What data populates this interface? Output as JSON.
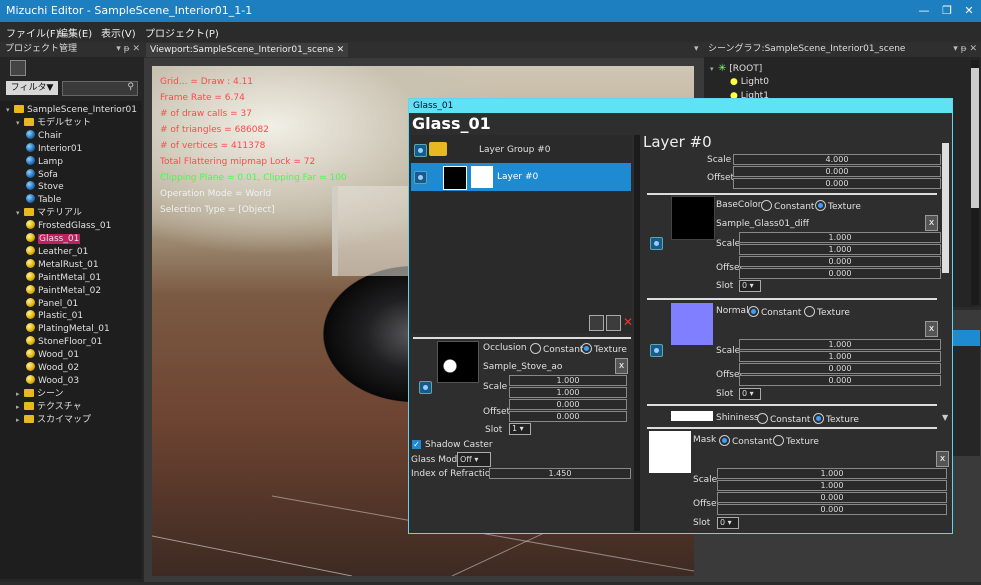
{
  "app": {
    "title": "Mizuchi Editor - SampleScene_Interior01_1-1"
  },
  "menu": [
    "ファイル(F)",
    "編集(E)",
    "表示(V)",
    "プロジェクト(P)"
  ],
  "project_panel": {
    "title": "プロジェクト管理",
    "filter_label": "フィルタ▼",
    "tree": [
      {
        "label": "SampleScene_Interior01",
        "icon": "folder",
        "indent": 0
      },
      {
        "label": "モデルセット",
        "icon": "folder",
        "indent": 1
      },
      {
        "label": "Chair",
        "icon": "blue",
        "indent": 2
      },
      {
        "label": "Interior01",
        "icon": "blue",
        "indent": 2
      },
      {
        "label": "Lamp",
        "icon": "blue",
        "indent": 2
      },
      {
        "label": "Sofa",
        "icon": "blue",
        "indent": 2
      },
      {
        "label": "Stove",
        "icon": "blue",
        "indent": 2
      },
      {
        "label": "Table",
        "icon": "blue",
        "indent": 2
      },
      {
        "label": "マテリアル",
        "icon": "folder",
        "indent": 1
      },
      {
        "label": "FrostedGlass_01",
        "icon": "gold",
        "indent": 2
      },
      {
        "label": "Glass_01",
        "icon": "gold",
        "indent": 2,
        "selected": true
      },
      {
        "label": "Leather_01",
        "icon": "gold",
        "indent": 2
      },
      {
        "label": "MetalRust_01",
        "icon": "gold",
        "indent": 2
      },
      {
        "label": "PaintMetal_01",
        "icon": "gold",
        "indent": 2
      },
      {
        "label": "PaintMetal_02",
        "icon": "gold",
        "indent": 2
      },
      {
        "label": "Panel_01",
        "icon": "gold",
        "indent": 2
      },
      {
        "label": "Plastic_01",
        "icon": "gold",
        "indent": 2
      },
      {
        "label": "PlatingMetal_01",
        "icon": "gold",
        "indent": 2
      },
      {
        "label": "StoneFloor_01",
        "icon": "gold",
        "indent": 2
      },
      {
        "label": "Wood_01",
        "icon": "gold",
        "indent": 2
      },
      {
        "label": "Wood_02",
        "icon": "gold",
        "indent": 2
      },
      {
        "label": "Wood_03",
        "icon": "gold",
        "indent": 2
      },
      {
        "label": "シーン",
        "icon": "folder",
        "indent": 1
      },
      {
        "label": "テクスチャ",
        "icon": "folder",
        "indent": 1
      },
      {
        "label": "スカイマップ",
        "icon": "folder",
        "indent": 1
      }
    ]
  },
  "viewport": {
    "tab": "Viewport:SampleScene_Interior01_scene",
    "overlay": [
      "Grid... = Draw : 4.11",
      "Frame Rate = 6.74",
      "# of draw calls = 37",
      "# of triangles = 686082",
      "# of vertices = 411378",
      "Total Flattering mipmap Lock = 72",
      "Clipping Plane = 0.01, Clipping Far = 100",
      "Operation Mode = World",
      "Selection Type = [Object]"
    ]
  },
  "scene_graph": {
    "title": "シーングラフ:SampleScene_Interior01_scene",
    "items": [
      "[ROOT]",
      "Light0",
      "Light1"
    ]
  },
  "dialog": {
    "title": "Glass_01",
    "heading": "Glass_01",
    "layers": [
      "Layer Group #0",
      "Layer #0"
    ],
    "occlusion": {
      "label": "Occlusion",
      "constant": "Constant",
      "texture": "Texture",
      "file": "Sample_Stove_ao",
      "scale_label": "Scale",
      "scale": [
        "1.000",
        "1.000"
      ],
      "offset_label": "Offset",
      "offset": [
        "0.000",
        "0.000"
      ],
      "slot_label": "Slot",
      "slot": "1"
    },
    "shadow_caster": "Shadow Caster",
    "glass_mode_label": "Glass Mode",
    "glass_mode": "Off",
    "ior_label": "Index of Refraction",
    "ior": "1.450",
    "layer_heading": "Layer #0",
    "layer_scale_label": "Scale",
    "layer_scale": "4.000",
    "layer_offset_label": "Offset",
    "layer_offset": [
      "0.000",
      "0.000"
    ],
    "basecolor": {
      "label": "BaseColor",
      "constant": "Constant",
      "texture": "Texture",
      "file": "Sample_Glass01_diff",
      "scale_label": "Scale",
      "scale": [
        "1.000",
        "1.000"
      ],
      "offset_label": "Offset",
      "offset": [
        "0.000",
        "0.000"
      ],
      "slot_label": "Slot",
      "slot": "0"
    },
    "normal": {
      "label": "Normal",
      "constant": "Constant",
      "texture": "Texture",
      "scale_label": "Scale",
      "scale": [
        "1.000",
        "1.000"
      ],
      "offset_label": "Offset",
      "offset": [
        "0.000",
        "0.000"
      ],
      "slot_label": "Slot",
      "slot": "0",
      "color": "#7f7fff"
    },
    "shininess": {
      "label": "Shininess",
      "constant": "Constant",
      "texture": "Texture"
    },
    "mask": {
      "label": "Mask",
      "constant": "Constant",
      "texture": "Texture",
      "scale_label": "Scale",
      "scale": [
        "1.000",
        "1.000"
      ],
      "offset_label": "Offset",
      "offset": [
        "0.000",
        "0.000"
      ],
      "slot_label": "Slot",
      "slot": "0"
    },
    "x": "x"
  },
  "colors": {
    "titlebar": "#1d7fc0",
    "accent": "#5fe2f4",
    "selected_layer": "#1e8ad2",
    "overlay_red": "#ff4a4a",
    "overlay_green": "#42ff42"
  }
}
